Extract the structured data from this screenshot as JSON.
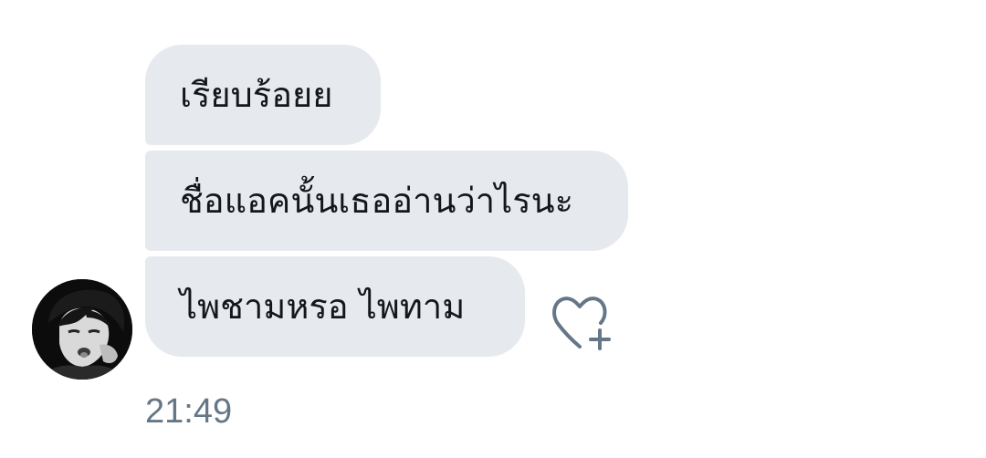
{
  "conversation": {
    "messages": [
      {
        "text": "เรียบร้อยย"
      },
      {
        "text": "ชื่อแอคนั้นเธออ่านว่าไรนะ"
      },
      {
        "text": "ไพชามหรอ ไพทาม"
      }
    ],
    "timestamp": "21:49",
    "avatar_icon": "user-avatar-photo",
    "like_icon": "heart-plus-icon",
    "colors": {
      "bubble": "#e6eaee",
      "text": "#14171a",
      "timestamp": "#657786",
      "icon": "#657786"
    }
  }
}
